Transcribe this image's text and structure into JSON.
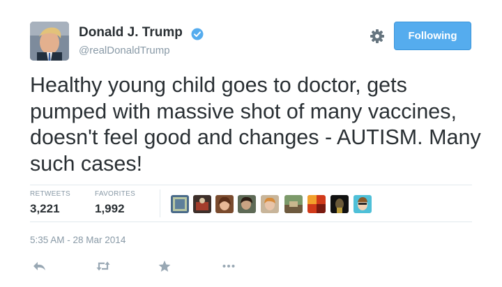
{
  "user": {
    "display_name": "Donald J. Trump",
    "handle": "@realDonaldTrump",
    "verified_icon": "verified-badge-icon",
    "avatar_icon": "profile-photo"
  },
  "header": {
    "settings_icon": "gear-icon",
    "follow_label": "Following"
  },
  "tweet": {
    "text": "Healthy young child goes to doctor, gets pumped with massive shot of many vaccines, doesn't feel good and changes - AUTISM. Many such cases!",
    "timestamp": "5:35 AM - 28 Mar 2014"
  },
  "stats": {
    "retweets_label": "RETWEETS",
    "retweets_count": "3,221",
    "favorites_label": "FAVORITES",
    "favorites_count": "1,992"
  },
  "favoriters": [
    {
      "icon": "favoriter-avatar"
    },
    {
      "icon": "favoriter-avatar"
    },
    {
      "icon": "favoriter-avatar"
    },
    {
      "icon": "favoriter-avatar"
    },
    {
      "icon": "favoriter-avatar"
    },
    {
      "icon": "favoriter-avatar"
    },
    {
      "icon": "favoriter-avatar"
    },
    {
      "icon": "favoriter-avatar"
    },
    {
      "icon": "favoriter-avatar"
    }
  ],
  "actions": [
    {
      "icon": "reply-icon"
    },
    {
      "icon": "retweet-icon"
    },
    {
      "icon": "favorite-star-icon"
    },
    {
      "icon": "more-icon"
    }
  ],
  "colors": {
    "accent": "#55acee",
    "text": "#292f33",
    "muted": "#8899a6",
    "divider": "#e1e8ed"
  }
}
